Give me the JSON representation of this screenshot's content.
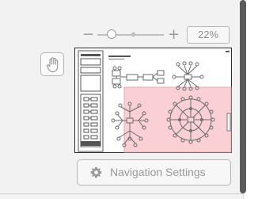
{
  "zoom": {
    "minus_symbol": "−",
    "plus_symbol": "+",
    "value": "22%",
    "slider_level_percent": 22
  },
  "tools": {
    "hand_icon": "hand-pan-icon"
  },
  "minimap": {
    "viewport_color": "#fbd0d4",
    "viewport_border_color": "#e8a9b0",
    "diagram_stroke_color": "#6b6b6b"
  },
  "navigation": {
    "settings_label": "Navigation Settings",
    "settings_icon": "gear-icon"
  }
}
